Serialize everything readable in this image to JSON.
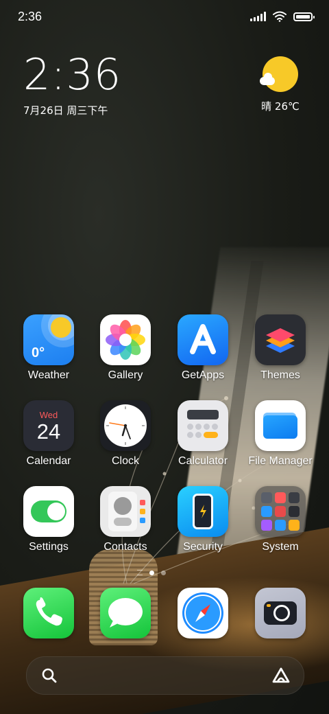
{
  "status_bar": {
    "time": "2:36"
  },
  "clock_widget": {
    "time": "2:36",
    "date": "7月26日 周三下午"
  },
  "weather_widget": {
    "text": "晴 26℃"
  },
  "apps": {
    "weather": {
      "label": "Weather",
      "temp": "0°"
    },
    "gallery": {
      "label": "Gallery"
    },
    "getapps": {
      "label": "GetApps"
    },
    "themes": {
      "label": "Themes"
    },
    "calendar": {
      "label": "Calendar",
      "day": "Wed",
      "date": "24"
    },
    "clock": {
      "label": "Clock"
    },
    "calculator": {
      "label": "Calculator"
    },
    "file_manager": {
      "label": "File Manager"
    },
    "settings": {
      "label": "Settings"
    },
    "contacts": {
      "label": "Contacts"
    },
    "security": {
      "label": "Security"
    },
    "system": {
      "label": "System"
    }
  },
  "dock": [
    "phone-icon",
    "messages-icon",
    "browser-icon",
    "camera-icon"
  ],
  "pager": {
    "pages": 2,
    "active": 1
  },
  "search": {
    "icons": [
      "search-icon",
      "assistant-icon"
    ]
  },
  "colors": {
    "weather_sun": "#f7c928",
    "settings_toggle": "#34c759",
    "calendar_day": "#ff5a5a"
  }
}
